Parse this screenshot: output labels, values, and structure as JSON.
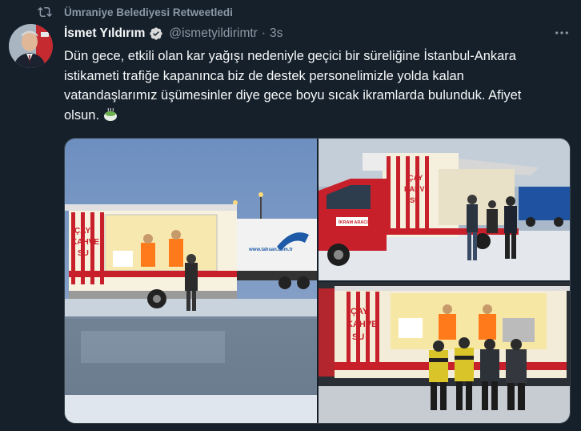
{
  "retweet": {
    "icon": "retweet-icon",
    "label": "Ümraniye Belediyesi Retweetledi"
  },
  "author": {
    "display_name": "İsmet Yıldırım",
    "handle": "@ismetyildirimtr",
    "separator": "·",
    "time": "3s",
    "verified_icon": "verified-badge-icon",
    "avatar_icon": "profile-avatar"
  },
  "more_icon": "more-options-icon",
  "tweet": {
    "text": "Dün gece, etkili olan kar yağışı nedeniyle geçici bir süreliğine İstanbul-Ankara istikameti trafiğe kapanınca biz de destek personelimizle yolda kalan vatandaşlarımız üşümesinler diye gece boyu sıcak ikramlarda bulunduk. Afiyet olsun.",
    "emoji_icon": "hot-beverage-emoji-icon"
  },
  "media": {
    "photos": [
      {
        "name": "photo-catering-truck-night",
        "truck_lines": [
          "ÇAY",
          "KAHVE",
          "SU"
        ],
        "trailer_text": "www.tahsan.com.tr"
      },
      {
        "name": "photo-catering-truck-day",
        "truck_lines": [
          "ÇAY",
          "KAHVE",
          "SU"
        ],
        "badge_text": "İKRAM ARACI"
      },
      {
        "name": "photo-staff-group",
        "truck_lines": [
          "ÇAY",
          "KAHVE",
          "SU"
        ]
      }
    ]
  },
  "colors": {
    "background": "#15202b",
    "text": "#f7f9f9",
    "muted": "#8b98a5",
    "verified": "#d9d9d9",
    "truck_red": "#c8202a"
  }
}
